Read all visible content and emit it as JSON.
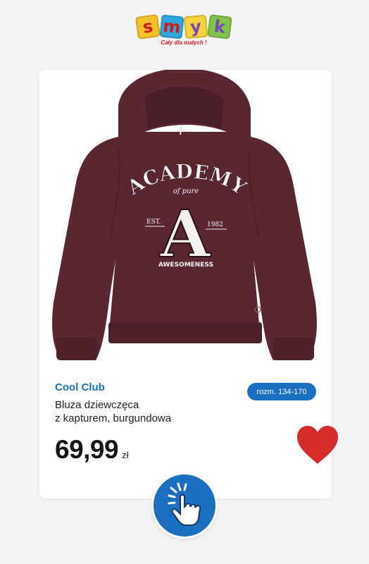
{
  "logo": {
    "letters": [
      "s",
      "m",
      "y",
      "k"
    ],
    "tile_colors": [
      "#f5c12b",
      "#2fa7e0",
      "#f6d33a",
      "#7fc54b"
    ],
    "tagline": "Cały dla małych !"
  },
  "product": {
    "brand": "Cool Club",
    "name_line1": "Bluza dziewczęca",
    "name_line2": "z kapturem, burgundowa",
    "price": "69,99",
    "currency": "zł",
    "size_label": "rozm. 134-170",
    "print_text": {
      "top": "ACADEMY",
      "script": "of pure",
      "letter": "A",
      "left": "EST.",
      "right": "1982",
      "bottom": "AWESOMENESS"
    },
    "garment_color": "#5a2730"
  },
  "colors": {
    "accent": "#1b6fc1",
    "heart": "#d72b2b",
    "brand_text": "#1d6fb8"
  },
  "icons": {
    "favorite": "heart-icon",
    "tap": "hand-tap-icon"
  }
}
